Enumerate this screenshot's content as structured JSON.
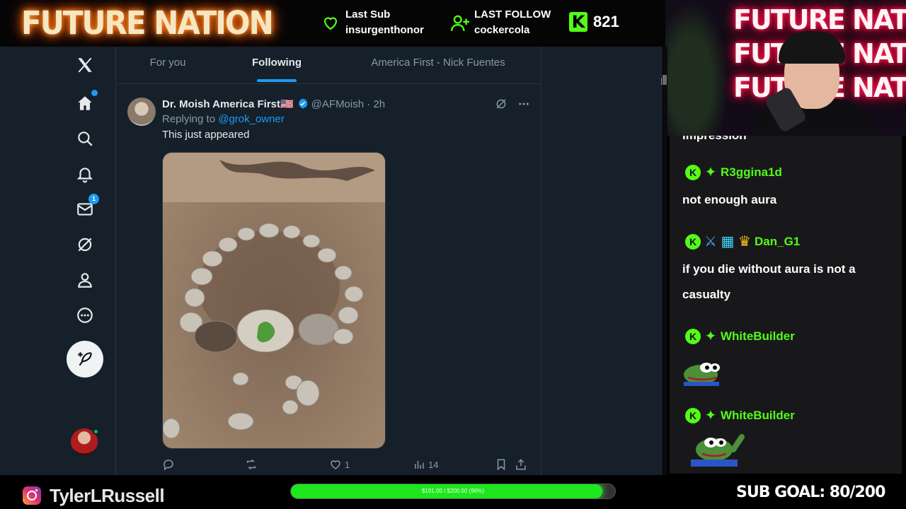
{
  "overlay": {
    "brand": "FUTURE NATION",
    "last_sub": {
      "label": "Last Sub",
      "user": "insurgenthonor"
    },
    "last_follow": {
      "label": "LAST FOLLOW",
      "user": "cockercola"
    },
    "kick": {
      "icon": "kick-logo-icon",
      "count": "821"
    },
    "webcam_sign": "FUTURE NATION"
  },
  "twitter": {
    "tabs": [
      {
        "label": "For you"
      },
      {
        "label": "Following"
      },
      {
        "label": "America First - Nick Fuentes"
      }
    ],
    "active_tab": "Following",
    "nav_icons": [
      "x-logo-icon",
      "home-icon",
      "search-icon",
      "bell-icon",
      "mail-icon",
      "grok-icon",
      "profile-icon",
      "more-icon"
    ],
    "messages_badge": "1",
    "tweet": {
      "name": "Dr. Moish America First🇺🇸",
      "handle": "@AFMoish · 2h",
      "replying_prefix": "Replying to ",
      "replying_to": "@grok_owner",
      "text": "This just appeared",
      "likes": "1",
      "views": "14"
    }
  },
  "chat": {
    "cut_text": "impression",
    "messages": [
      {
        "user": "R3ggina1d",
        "text": "not enough aura"
      },
      {
        "user": "Dan_G1",
        "text": "if you die without aura is not a casualty"
      },
      {
        "user": "WhiteBuilder",
        "emote": "pepe-emote"
      },
      {
        "user": "WhiteBuilder",
        "emote": "pepe-wave-emote"
      }
    ]
  },
  "bottom": {
    "social_icon": "instagram-icon",
    "handle": "TylerLRussell",
    "goal_text": "$191.00 / $200.00 (96%)",
    "goal_fraction": 0.96,
    "sub_goal": "SUB GOAL: 80/200"
  },
  "colors": {
    "kick_green": "#53fc18",
    "twitter_bg": "#15202b",
    "twitter_blue": "#1d9bf0"
  }
}
